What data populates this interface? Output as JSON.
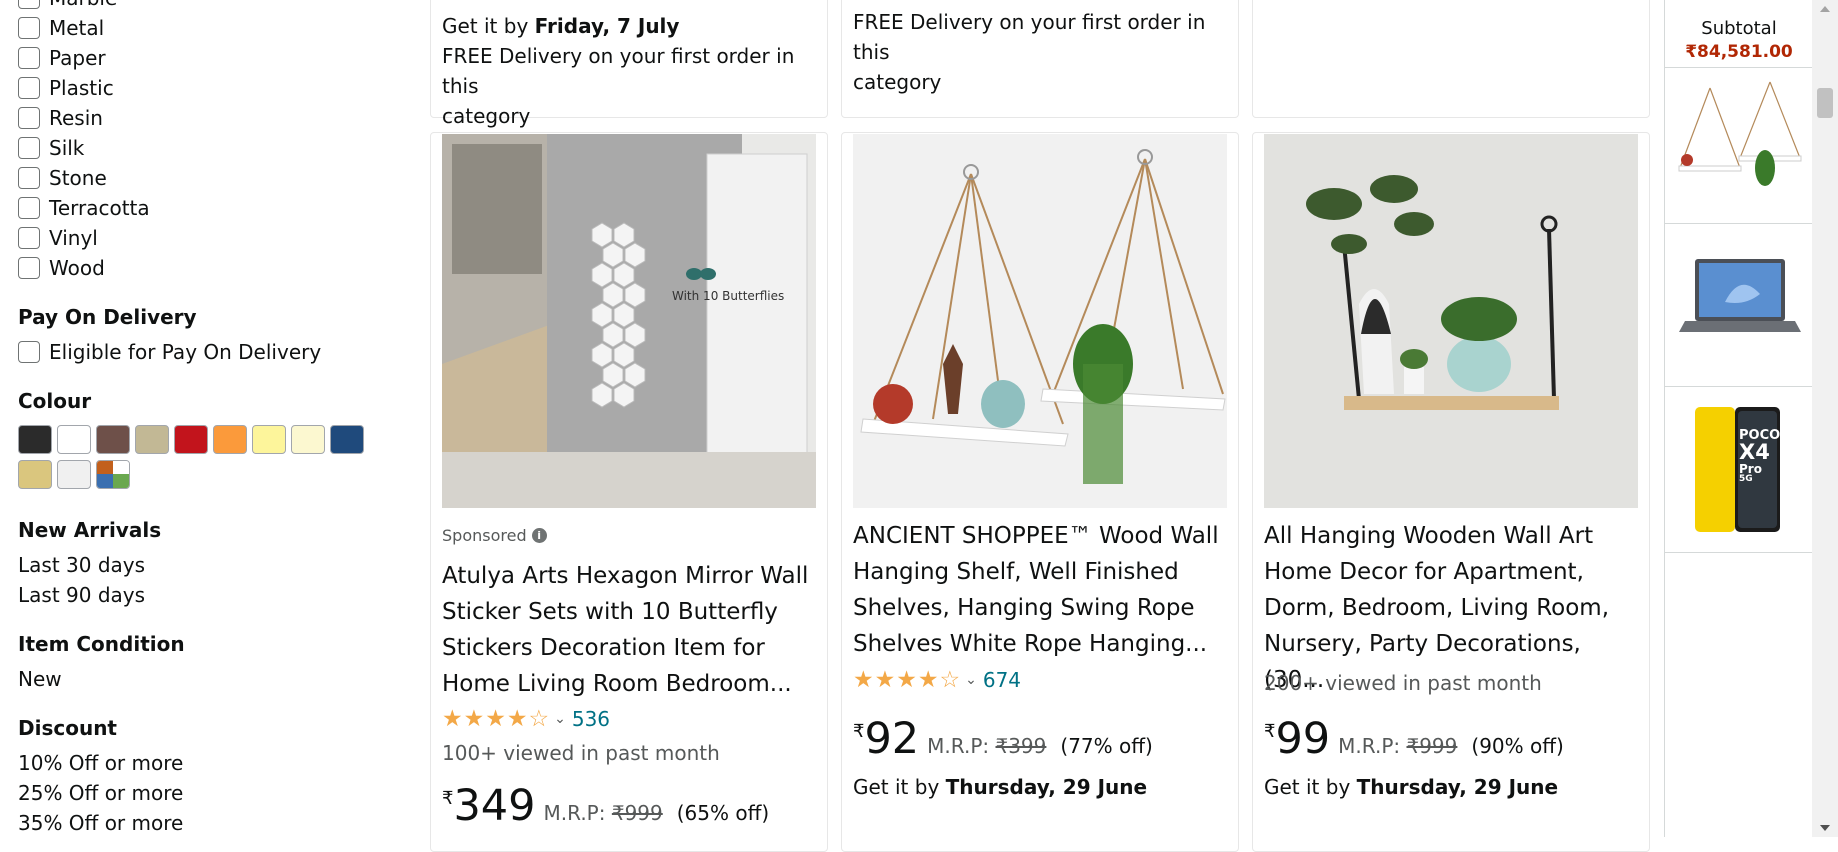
{
  "filters": {
    "partial_label": "Marble",
    "materials": [
      "Metal",
      "Paper",
      "Plastic",
      "Resin",
      "Silk",
      "Stone",
      "Terracotta",
      "Vinyl",
      "Wood"
    ],
    "pay_on_delivery": {
      "heading": "Pay On Delivery",
      "option": "Eligible for Pay On Delivery"
    },
    "colour": {
      "heading": "Colour",
      "swatches": [
        "#2b2b2b",
        "#ffffff",
        "#6e5049",
        "#c2b895",
        "#c2141c",
        "#fb9a3b",
        "#fdf59b",
        "#fcf8d0",
        "#1f4a7c",
        "#dac67e",
        "#f0f0f0",
        "multi"
      ]
    },
    "new_arrivals": {
      "heading": "New Arrivals",
      "options": [
        "Last 30 days",
        "Last 90 days"
      ]
    },
    "item_condition": {
      "heading": "Item Condition",
      "options": [
        "New"
      ]
    },
    "discount": {
      "heading": "Discount",
      "options": [
        "10% Off or more",
        "25% Off or more",
        "35% Off or more"
      ]
    }
  },
  "top_cards": {
    "col1": {
      "delivery_prefix": "Get it by ",
      "delivery_date": "Friday, 7 July",
      "free_line1": "FREE Delivery on your first order in this",
      "free_line2": "category"
    },
    "col2": {
      "free_line1": "FREE Delivery on your first order in this",
      "free_line2": "category"
    }
  },
  "products": [
    {
      "sponsored": "Sponsored",
      "image_overlay": "With 10 Butterflies",
      "title_lines": [
        "Atulya Arts Hexagon Mirror Wall",
        "Sticker Sets with 10 Butterfly",
        "Stickers Decoration Item for",
        "Home Living Room Bedroom..."
      ],
      "rating": 4.0,
      "rating_count": "536",
      "viewed": "100+ viewed in past month",
      "currency": "₹",
      "price": "349",
      "mrp_label": "M.R.P: ",
      "mrp": "₹999",
      "discount": "(65% off)"
    },
    {
      "title_lines": [
        "ANCIENT SHOPPEE™ Wood Wall",
        "Hanging Shelf, Well Finished",
        "Shelves, Hanging Swing Rope",
        "Shelves White Rope Hanging..."
      ],
      "rating": 4.0,
      "rating_count": "674",
      "currency": "₹",
      "price": "92",
      "mrp_label": "M.R.P: ",
      "mrp": "₹399",
      "discount": "(77% off)",
      "delivery_prefix": "Get it by ",
      "delivery_date": "Thursday, 29 June"
    },
    {
      "title_lines": [
        "All Hanging Wooden Wall Art",
        "Home Decor for Apartment,",
        "Dorm, Bedroom, Living Room,",
        "Nursery, Party Decorations, (30..."
      ],
      "viewed": "200+ viewed in past month",
      "currency": "₹",
      "price": "99",
      "mrp_label": "M.R.P: ",
      "mrp": "₹999",
      "discount": "(90% off)",
      "delivery_prefix": "Get it by ",
      "delivery_date": "Thursday, 29 June"
    }
  ],
  "cart": {
    "subtotal_label": "Subtotal",
    "subtotal_value": "₹84,581.00",
    "items": [
      "hanging-shelf-thumbnail",
      "laptop-thumbnail",
      "poco-x4-pro-phone-thumbnail"
    ],
    "phone_text": [
      "POCO",
      "X4",
      "Pro",
      "5G"
    ]
  }
}
